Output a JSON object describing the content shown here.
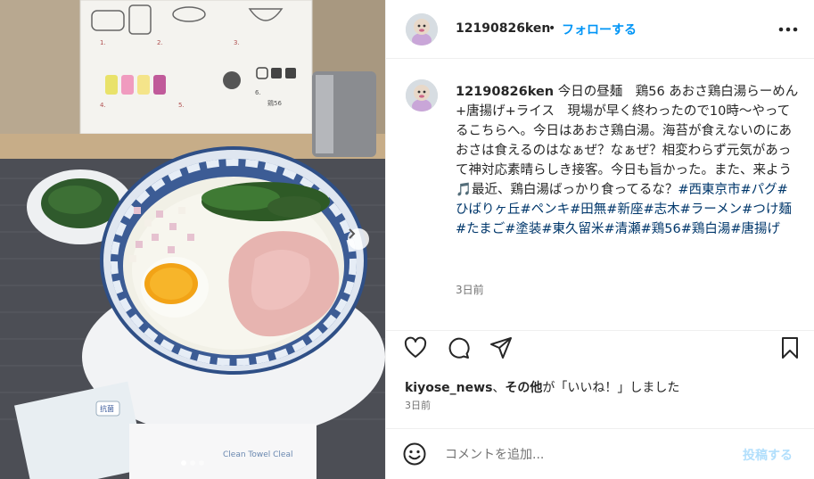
{
  "post": {
    "carousel": {
      "slide_count": 3,
      "active_index": 0
    },
    "photo": {
      "menu_card_numbers": [
        "1.",
        "2.",
        "3.",
        "4.",
        "5.",
        "6."
      ],
      "menu_card_text": "鶏56",
      "cup_label": "Clean Towel Cleal",
      "towel_tag": "抗菌"
    }
  },
  "header": {
    "username": "12190826ken",
    "separator": "•",
    "follow_label": "フォローする",
    "more_icon": "more-horizontal-icon"
  },
  "caption": {
    "username": "12190826ken",
    "text": "今日の昼麺　鶏56 あおさ鶏白湯らーめん+唐揚げ+ライス　現場が早く終わったので10時〜やってるこちらへ。今日はあおさ鶏白湯。海苔が食えないのにあおさは食えるのはなぁぜ？なぁぜ？相変わらず元気があって神対応素晴らしき接客。今日も旨かった。また、来よう🎵最近、鶏白湯ばっかり食ってるな？",
    "hashtags": "#西東京市#パグ#ひばりヶ丘#ペンキ#田無#新座#志木#ラーメン#つけ麺#たまご#塗装#東久留米#清瀬#鶏56#鶏白湯#唐揚げ",
    "time": "3日前"
  },
  "actions": {
    "like_icon": "heart-icon",
    "comment_icon": "comment-icon",
    "share_icon": "share-icon",
    "save_icon": "bookmark-icon"
  },
  "likes": {
    "user": "kiyose_news",
    "middle": "、",
    "others": "その他",
    "suffix": "が「いいね！」しました"
  },
  "post_time": "3日前",
  "comment_bar": {
    "placeholder": "コメントを追加...",
    "post_label": "投稿する",
    "emoji_icon": "emoji-icon"
  },
  "colors": {
    "link_blue": "#0095f6",
    "hashtag_blue": "#00376b",
    "muted": "#737373",
    "post_disabled": "#b2dffc"
  }
}
